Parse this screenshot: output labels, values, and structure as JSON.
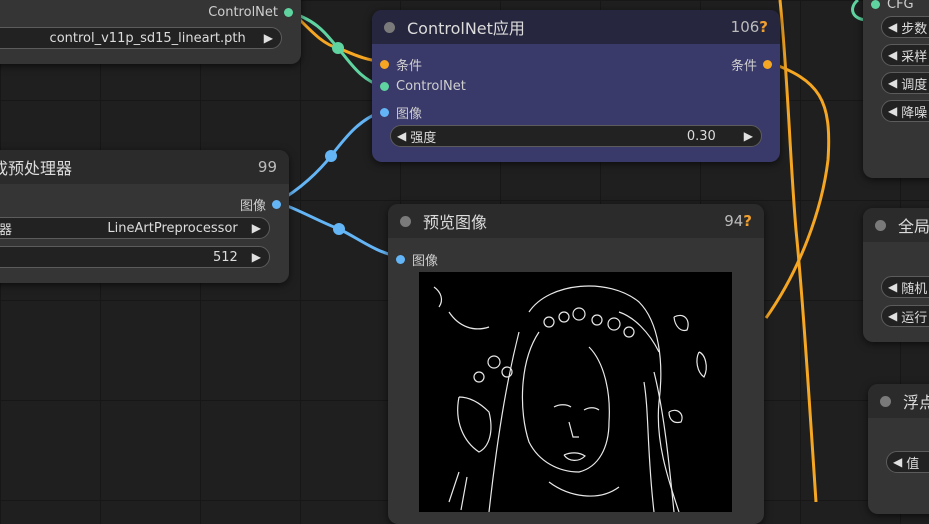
{
  "colors": {
    "conditioning": "#f5a623",
    "controlnet": "#5fd4a0",
    "image": "#64b5f6"
  },
  "loader_node": {
    "output_label": "ControlNet",
    "model_value": "control_v11p_sd15_lineart.pth"
  },
  "preprocessor_node": {
    "title": "成预处理器",
    "id": "99",
    "output_label": "图像",
    "preprocessor_label": "器",
    "preprocessor_value": "LineArtPreprocessor",
    "resolution_value": "512"
  },
  "apply_node": {
    "title": "ControlNet应用",
    "id": "106",
    "id_badge": "?",
    "inputs": [
      "条件",
      "ControlNet",
      "图像"
    ],
    "output_label": "条件",
    "strength_label": "强度",
    "strength_value": "0.30"
  },
  "preview_node": {
    "title": "预览图像",
    "id": "94",
    "id_badge": "?",
    "input_label": "图像",
    "image_desc": "line-art portrait of a woman with flowers in her hair"
  },
  "right_node_1": {
    "title": "CFG",
    "widgets": [
      "步数",
      "采样",
      "调度",
      "降噪"
    ]
  },
  "right_node_2": {
    "title": "全局",
    "widgets": [
      "随机",
      "运行"
    ]
  },
  "right_node_3": {
    "title": "浮点",
    "widgets": [
      "值"
    ]
  }
}
